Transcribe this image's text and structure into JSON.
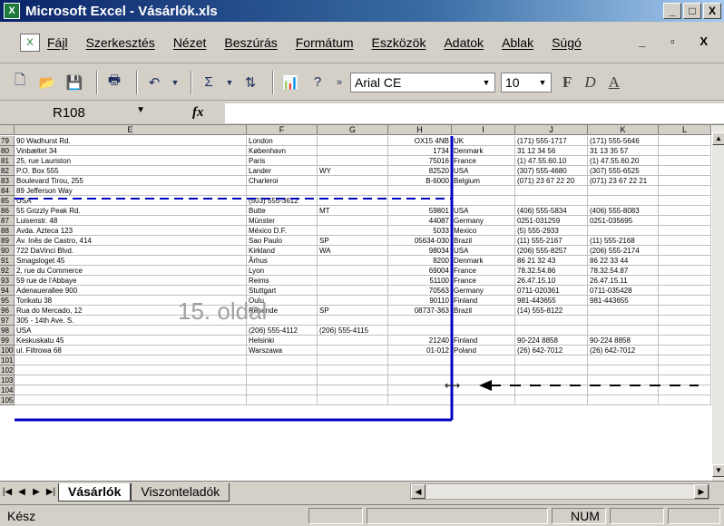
{
  "window": {
    "title": "Microsoft Excel - Vásárlók.xls",
    "app_icon": "excel-icon",
    "buttons": [
      "_",
      "□",
      "X"
    ]
  },
  "menu": [
    "Fájl",
    "Szerkesztés",
    "Nézet",
    "Beszúrás",
    "Formátum",
    "Eszközök",
    "Adatok",
    "Ablak",
    "Súgó"
  ],
  "mdi_controls": "_ ▫ X",
  "toolbar": {
    "font_name": "Arial CE",
    "font_size": "10",
    "bold": "F",
    "italic": "D",
    "underline": "A"
  },
  "formula_bar": {
    "name_box": "R108",
    "fx": "fx",
    "content": ""
  },
  "columns": [
    "E",
    "F",
    "G",
    "H",
    "I",
    "J",
    "K",
    "L"
  ],
  "rows": [
    {
      "n": "79",
      "E": "90 Wadhurst Rd.",
      "F": "London",
      "G": "",
      "H": "OX15 4NB",
      "I": "UK",
      "J": "(171) 555-1717",
      "K": "(171) 555-5646"
    },
    {
      "n": "80",
      "E": "Vinbæltet 34",
      "F": "København",
      "G": "",
      "H": "1734",
      "I": "Denmark",
      "J": "31 12 34 56",
      "K": "31 13 35 57"
    },
    {
      "n": "81",
      "E": "25, rue Lauriston",
      "F": "Paris",
      "G": "",
      "H": "75016",
      "I": "France",
      "J": "(1) 47.55.60.10",
      "K": "(1) 47.55.60.20"
    },
    {
      "n": "82",
      "E": "P.O. Box 555",
      "F": "Lander",
      "G": "WY",
      "H": "82520",
      "I": "USA",
      "J": "(307) 555-4680",
      "K": "(307) 555-6525"
    },
    {
      "n": "83",
      "E": "Boulevard Tirou, 255",
      "F": "Charleroi",
      "G": "",
      "H": "B-6000",
      "I": "Belgium",
      "J": "(071) 23 67 22 20",
      "K": "(071) 23 67 22 21"
    },
    {
      "n": "84",
      "E": "89 Jefferson Way",
      "F": "",
      "G": "",
      "H": "",
      "I": "",
      "J": "",
      "K": ""
    },
    {
      "n": "85",
      "E": "USA",
      "F": "(503) 555-3612",
      "G": "",
      "H": "",
      "I": "",
      "J": "",
      "K": ""
    },
    {
      "n": "86",
      "E": "55 Grizzly Peak Rd.",
      "F": "Butte",
      "G": "MT",
      "H": "59801",
      "I": "USA",
      "J": "(406) 555-5834",
      "K": "(406) 555-8083"
    },
    {
      "n": "87",
      "E": "Luisenstr. 48",
      "F": "Münster",
      "G": "",
      "H": "44087",
      "I": "Germany",
      "J": "0251-031259",
      "K": "0251-035695"
    },
    {
      "n": "88",
      "E": "Avda. Azteca 123",
      "F": "México D.F.",
      "G": "",
      "H": "5033",
      "I": "Mexico",
      "J": "(5) 555-2933",
      "K": ""
    },
    {
      "n": "89",
      "E": "Av. Inês de Castro, 414",
      "F": "Sao Paulo",
      "G": "SP",
      "H": "05634-030",
      "I": "Brazil",
      "J": "(11) 555-2167",
      "K": "(11) 555-2168"
    },
    {
      "n": "90",
      "E": "722 DaVinci Blvd.",
      "F": "Kirkland",
      "G": "WA",
      "H": "98034",
      "I": "USA",
      "J": "(206) 555-8257",
      "K": "(206) 555-2174"
    },
    {
      "n": "91",
      "E": "Smagsloget 45",
      "F": "Århus",
      "G": "",
      "H": "8200",
      "I": "Denmark",
      "J": "86 21 32 43",
      "K": "86 22 33 44"
    },
    {
      "n": "92",
      "E": "2, rue du Commerce",
      "F": "Lyon",
      "G": "",
      "H": "69004",
      "I": "France",
      "J": "78.32.54.86",
      "K": "78.32.54.87"
    },
    {
      "n": "93",
      "E": "59 rue de l'Abbaye",
      "F": "Reims",
      "G": "",
      "H": "51100",
      "I": "France",
      "J": "26.47.15.10",
      "K": "26.47.15.11"
    },
    {
      "n": "94",
      "E": "Adenauerallee 900",
      "F": "Stuttgart",
      "G": "",
      "H": "70563",
      "I": "Germany",
      "J": "0711-020361",
      "K": "0711-035428"
    },
    {
      "n": "95",
      "E": "Torikatu 38",
      "F": "Oulu",
      "G": "",
      "H": "90110",
      "I": "Finland",
      "J": "981-443655",
      "K": "981-443655"
    },
    {
      "n": "96",
      "E": "Rua do Mercado, 12",
      "F": "Resende",
      "G": "SP",
      "H": "08737-363",
      "I": "Brazil",
      "J": "(14) 555-8122",
      "K": ""
    },
    {
      "n": "97",
      "E": "305 - 14th Ave. S.",
      "F": "",
      "G": "",
      "H": "",
      "I": "",
      "J": "",
      "K": ""
    },
    {
      "n": "98",
      "E": "USA",
      "F": "(206) 555-4112",
      "G": "(206) 555-4115",
      "H": "",
      "I": "",
      "J": "",
      "K": ""
    },
    {
      "n": "99",
      "E": "Keskuskatu 45",
      "F": "Helsinki",
      "G": "",
      "H": "21240",
      "I": "Finland",
      "J": "90-224 8858",
      "K": "90-224 8858"
    },
    {
      "n": "100",
      "E": "ul. Filtrowa 68",
      "F": "Warszawa",
      "G": "",
      "H": "01-012",
      "I": "Poland",
      "J": "(26) 642-7012",
      "K": "(26) 642-7012"
    },
    {
      "n": "101",
      "E": "",
      "F": "",
      "G": "",
      "H": "",
      "I": "",
      "J": "",
      "K": ""
    },
    {
      "n": "102",
      "E": "",
      "F": "",
      "G": "",
      "H": "",
      "I": "",
      "J": "",
      "K": ""
    },
    {
      "n": "103",
      "E": "",
      "F": "",
      "G": "",
      "H": "",
      "I": "",
      "J": "",
      "K": ""
    },
    {
      "n": "104",
      "E": "",
      "F": "",
      "G": "",
      "H": "",
      "I": "",
      "J": "",
      "K": ""
    },
    {
      "n": "105",
      "E": "",
      "F": "",
      "G": "",
      "H": "",
      "I": "",
      "J": "",
      "K": ""
    }
  ],
  "page_watermark": "15. oldal",
  "sheets": [
    "Vásárlók",
    "Viszonteladók"
  ],
  "status": {
    "left": "Kész",
    "num": "NUM"
  },
  "colors": {
    "titlebar": "#0a246a",
    "page_break": "#0000c0",
    "watermark": "#a0a0a0"
  }
}
